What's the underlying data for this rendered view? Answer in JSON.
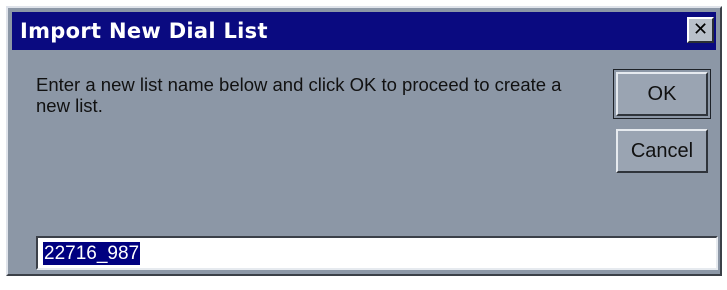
{
  "window": {
    "title": "Import New Dial List",
    "close_glyph": "✕"
  },
  "body": {
    "message": "Enter a new list name below and click OK to proceed to create a new list."
  },
  "buttons": {
    "ok_label": "OK",
    "cancel_label": "Cancel"
  },
  "list_name": {
    "value": "22716_987",
    "selected": true
  },
  "colors": {
    "titlebar": "#0a0a80",
    "dialog_bg": "#8c97a6",
    "selection": "#000080"
  }
}
